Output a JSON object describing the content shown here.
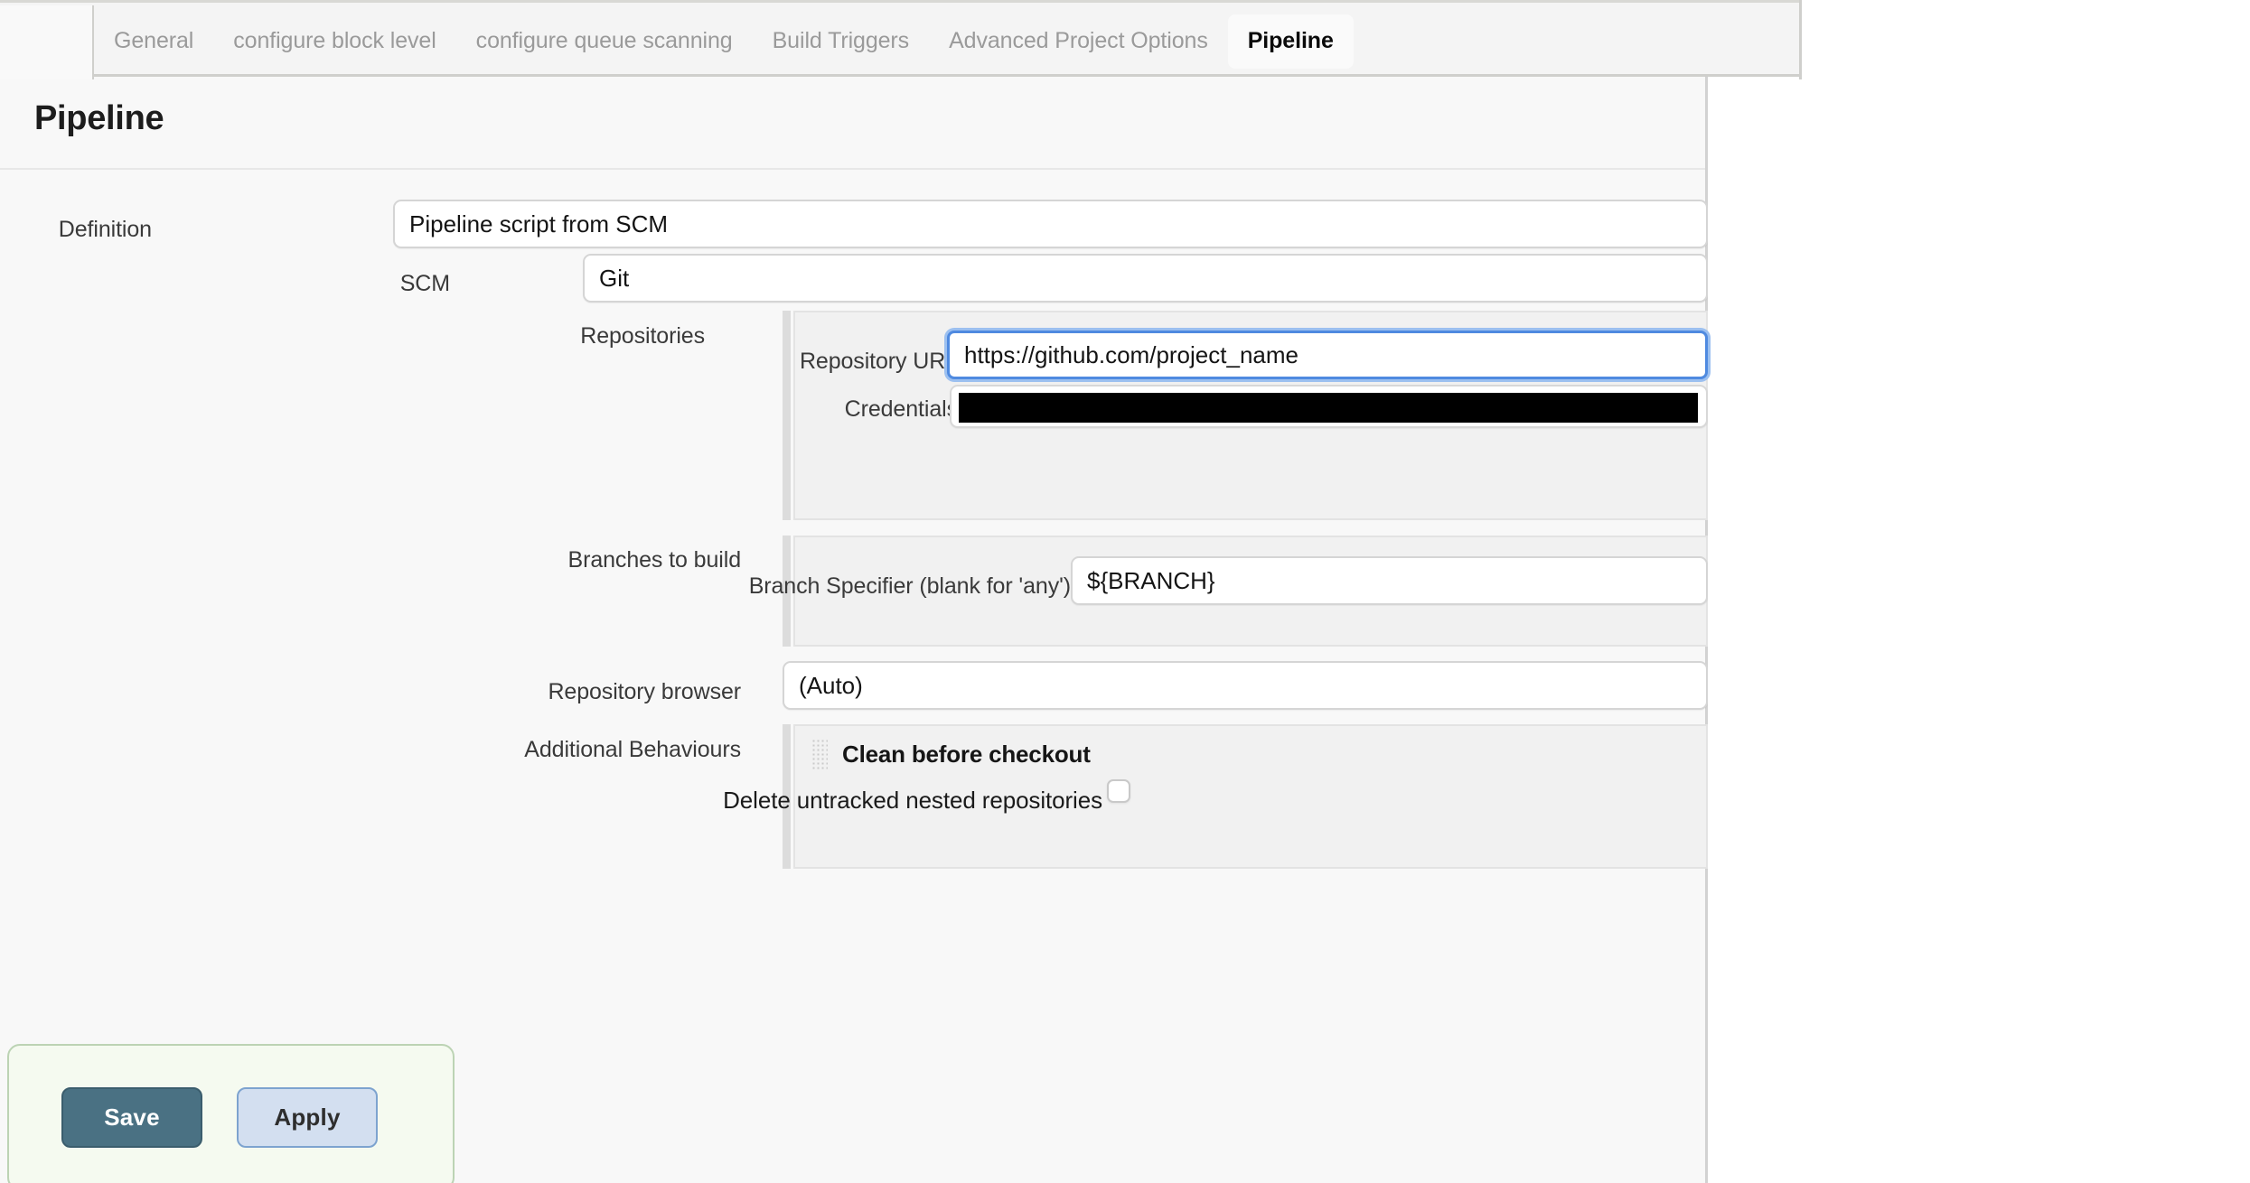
{
  "tabs": [
    {
      "label": "General",
      "active": false
    },
    {
      "label": "configure block level",
      "active": false
    },
    {
      "label": "configure queue scanning",
      "active": false
    },
    {
      "label": "Build Triggers",
      "active": false
    },
    {
      "label": "Advanced Project Options",
      "active": false
    },
    {
      "label": "Pipeline",
      "active": true
    }
  ],
  "page": {
    "title": "Pipeline"
  },
  "definition": {
    "label": "Definition",
    "value": "Pipeline script from SCM"
  },
  "scm": {
    "label": "SCM",
    "value": "Git"
  },
  "repositories": {
    "label": "Repositories",
    "url": {
      "label": "Repository URL",
      "value": "https://github.com/project_name"
    },
    "credentials": {
      "label": "Credentials",
      "value": ""
    }
  },
  "branches": {
    "label": "Branches to build",
    "specifier": {
      "label": "Branch Specifier (blank for 'any')",
      "value": "${BRANCH}"
    }
  },
  "repository_browser": {
    "label": "Repository browser",
    "value": "(Auto)"
  },
  "additional_behaviours": {
    "label": "Additional Behaviours",
    "items": [
      {
        "title": "Clean before checkout",
        "option_label": "Delete untracked nested repositories",
        "checked": false
      }
    ]
  },
  "actions": {
    "save_label": "Save",
    "apply_label": "Apply"
  },
  "colors": {
    "save_bg": "#4a7183",
    "apply_bg": "#d3dff0",
    "focus_ring": "#4f8ae0",
    "savebar_bg": "#f5faf0"
  }
}
